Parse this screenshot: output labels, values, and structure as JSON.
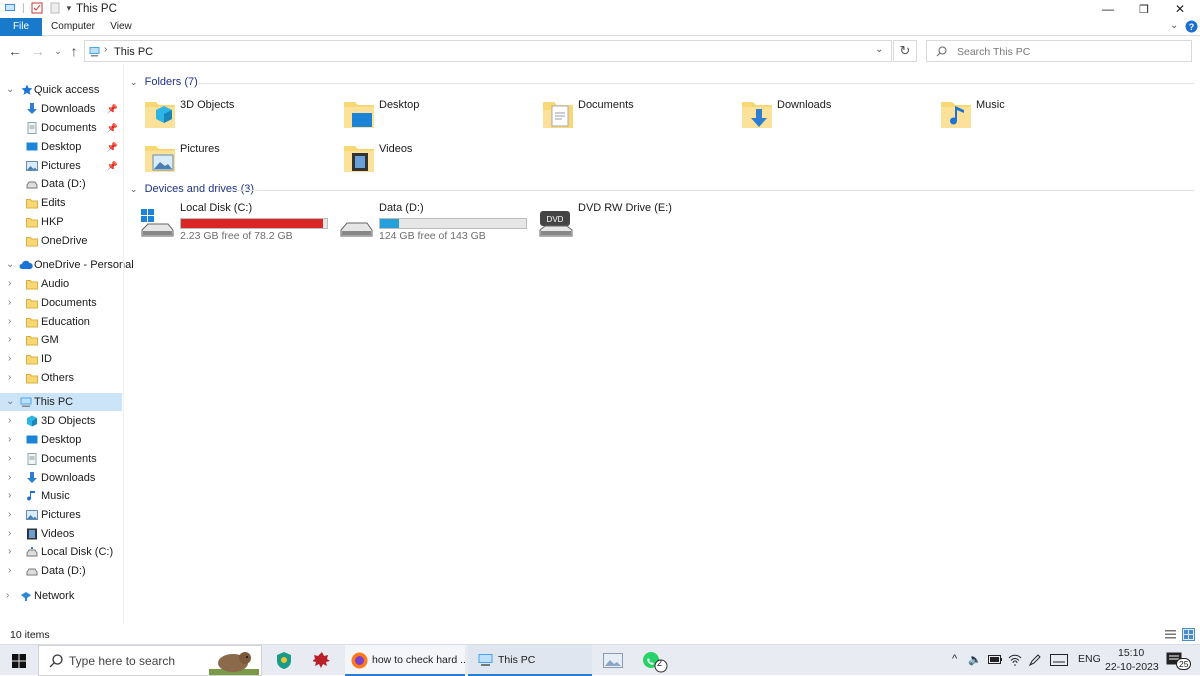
{
  "window": {
    "title": "This PC"
  },
  "ribbon": {
    "tabs": [
      "File",
      "Computer",
      "View"
    ]
  },
  "address": {
    "path": "This PC",
    "search_placeholder": "Search This PC"
  },
  "nav": {
    "quick_access": "Quick access",
    "quick_items": [
      "Downloads",
      "Documents",
      "Desktop",
      "Pictures",
      "Data (D:)",
      "Edits",
      "HKP",
      "OneDrive"
    ],
    "onedrive": "OneDrive - Personal",
    "onedrive_items": [
      "Audio",
      "Documents",
      "Education",
      "GM",
      "ID",
      "Others"
    ],
    "this_pc": "This PC",
    "this_pc_items": [
      "3D Objects",
      "Desktop",
      "Documents",
      "Downloads",
      "Music",
      "Pictures",
      "Videos",
      "Local Disk (C:)",
      "Data (D:)"
    ],
    "network": "Network"
  },
  "content": {
    "folders_header": "Folders (7)",
    "folders": [
      "3D Objects",
      "Desktop",
      "Documents",
      "Downloads",
      "Music",
      "Pictures",
      "Videos"
    ],
    "drives_header": "Devices and drives (3)",
    "drives": [
      {
        "name": "Local Disk (C:)",
        "free": "2.23 GB free of 78.2 GB",
        "used_fraction": 0.97,
        "bar_color": "#da2626"
      },
      {
        "name": "Data (D:)",
        "free": "124 GB free of 143 GB",
        "used_fraction": 0.13,
        "bar_color": "#26a0da"
      },
      {
        "name": "DVD RW Drive (E:)"
      }
    ]
  },
  "status": {
    "items": "10 items"
  },
  "taskbar": {
    "search_placeholder": "Type here to search",
    "apps": [
      "how to check hard ...",
      "This PC"
    ],
    "whatsapp_badge": "2",
    "lang": "ENG",
    "time": "15:10",
    "date": "22-10-2023",
    "notification_count": "25"
  },
  "colors": {
    "accent": "#1979ca",
    "selection": "#cce4f7",
    "header_text": "#1e3287"
  }
}
